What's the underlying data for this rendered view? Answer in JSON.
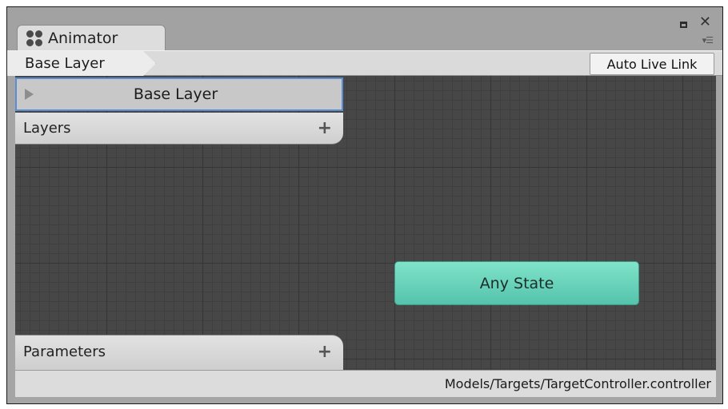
{
  "window": {
    "tab_label": "Animator",
    "tab_icon": "animator-icon"
  },
  "toolbar": {
    "breadcrumb": "Base Layer",
    "live_link_label": "Auto Live Link"
  },
  "layers": {
    "header": "Layers",
    "items": [
      {
        "label": "Base Layer",
        "selected": true
      }
    ]
  },
  "parameters": {
    "header": "Parameters"
  },
  "graph": {
    "nodes": [
      {
        "label": "Any State",
        "color": "#66d2b9"
      }
    ]
  },
  "status": {
    "path": "Models/Targets/TargetController.controller"
  },
  "colors": {
    "selection_outline": "#5a8ed3",
    "canvas": "#474747",
    "any_state": "#66d2b9"
  }
}
